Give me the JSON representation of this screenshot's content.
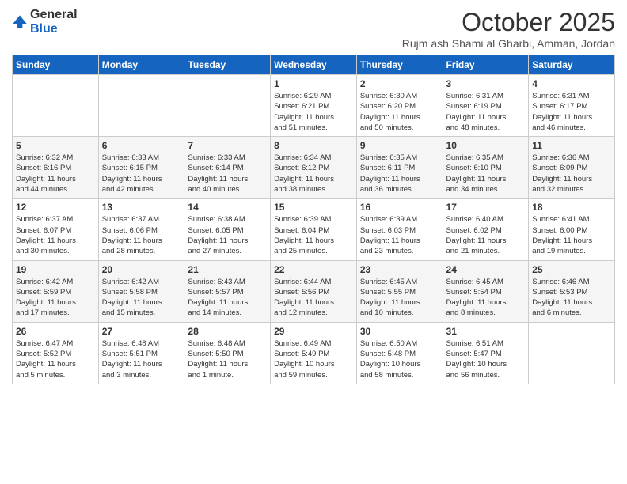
{
  "header": {
    "logo_general": "General",
    "logo_blue": "Blue",
    "month": "October 2025",
    "location": "Rujm ash Shami al Gharbi, Amman, Jordan"
  },
  "days_of_week": [
    "Sunday",
    "Monday",
    "Tuesday",
    "Wednesday",
    "Thursday",
    "Friday",
    "Saturday"
  ],
  "weeks": [
    [
      {
        "day": "",
        "info": ""
      },
      {
        "day": "",
        "info": ""
      },
      {
        "day": "",
        "info": ""
      },
      {
        "day": "1",
        "info": "Sunrise: 6:29 AM\nSunset: 6:21 PM\nDaylight: 11 hours\nand 51 minutes."
      },
      {
        "day": "2",
        "info": "Sunrise: 6:30 AM\nSunset: 6:20 PM\nDaylight: 11 hours\nand 50 minutes."
      },
      {
        "day": "3",
        "info": "Sunrise: 6:31 AM\nSunset: 6:19 PM\nDaylight: 11 hours\nand 48 minutes."
      },
      {
        "day": "4",
        "info": "Sunrise: 6:31 AM\nSunset: 6:17 PM\nDaylight: 11 hours\nand 46 minutes."
      }
    ],
    [
      {
        "day": "5",
        "info": "Sunrise: 6:32 AM\nSunset: 6:16 PM\nDaylight: 11 hours\nand 44 minutes."
      },
      {
        "day": "6",
        "info": "Sunrise: 6:33 AM\nSunset: 6:15 PM\nDaylight: 11 hours\nand 42 minutes."
      },
      {
        "day": "7",
        "info": "Sunrise: 6:33 AM\nSunset: 6:14 PM\nDaylight: 11 hours\nand 40 minutes."
      },
      {
        "day": "8",
        "info": "Sunrise: 6:34 AM\nSunset: 6:12 PM\nDaylight: 11 hours\nand 38 minutes."
      },
      {
        "day": "9",
        "info": "Sunrise: 6:35 AM\nSunset: 6:11 PM\nDaylight: 11 hours\nand 36 minutes."
      },
      {
        "day": "10",
        "info": "Sunrise: 6:35 AM\nSunset: 6:10 PM\nDaylight: 11 hours\nand 34 minutes."
      },
      {
        "day": "11",
        "info": "Sunrise: 6:36 AM\nSunset: 6:09 PM\nDaylight: 11 hours\nand 32 minutes."
      }
    ],
    [
      {
        "day": "12",
        "info": "Sunrise: 6:37 AM\nSunset: 6:07 PM\nDaylight: 11 hours\nand 30 minutes."
      },
      {
        "day": "13",
        "info": "Sunrise: 6:37 AM\nSunset: 6:06 PM\nDaylight: 11 hours\nand 28 minutes."
      },
      {
        "day": "14",
        "info": "Sunrise: 6:38 AM\nSunset: 6:05 PM\nDaylight: 11 hours\nand 27 minutes."
      },
      {
        "day": "15",
        "info": "Sunrise: 6:39 AM\nSunset: 6:04 PM\nDaylight: 11 hours\nand 25 minutes."
      },
      {
        "day": "16",
        "info": "Sunrise: 6:39 AM\nSunset: 6:03 PM\nDaylight: 11 hours\nand 23 minutes."
      },
      {
        "day": "17",
        "info": "Sunrise: 6:40 AM\nSunset: 6:02 PM\nDaylight: 11 hours\nand 21 minutes."
      },
      {
        "day": "18",
        "info": "Sunrise: 6:41 AM\nSunset: 6:00 PM\nDaylight: 11 hours\nand 19 minutes."
      }
    ],
    [
      {
        "day": "19",
        "info": "Sunrise: 6:42 AM\nSunset: 5:59 PM\nDaylight: 11 hours\nand 17 minutes."
      },
      {
        "day": "20",
        "info": "Sunrise: 6:42 AM\nSunset: 5:58 PM\nDaylight: 11 hours\nand 15 minutes."
      },
      {
        "day": "21",
        "info": "Sunrise: 6:43 AM\nSunset: 5:57 PM\nDaylight: 11 hours\nand 14 minutes."
      },
      {
        "day": "22",
        "info": "Sunrise: 6:44 AM\nSunset: 5:56 PM\nDaylight: 11 hours\nand 12 minutes."
      },
      {
        "day": "23",
        "info": "Sunrise: 6:45 AM\nSunset: 5:55 PM\nDaylight: 11 hours\nand 10 minutes."
      },
      {
        "day": "24",
        "info": "Sunrise: 6:45 AM\nSunset: 5:54 PM\nDaylight: 11 hours\nand 8 minutes."
      },
      {
        "day": "25",
        "info": "Sunrise: 6:46 AM\nSunset: 5:53 PM\nDaylight: 11 hours\nand 6 minutes."
      }
    ],
    [
      {
        "day": "26",
        "info": "Sunrise: 6:47 AM\nSunset: 5:52 PM\nDaylight: 11 hours\nand 5 minutes."
      },
      {
        "day": "27",
        "info": "Sunrise: 6:48 AM\nSunset: 5:51 PM\nDaylight: 11 hours\nand 3 minutes."
      },
      {
        "day": "28",
        "info": "Sunrise: 6:48 AM\nSunset: 5:50 PM\nDaylight: 11 hours\nand 1 minute."
      },
      {
        "day": "29",
        "info": "Sunrise: 6:49 AM\nSunset: 5:49 PM\nDaylight: 10 hours\nand 59 minutes."
      },
      {
        "day": "30",
        "info": "Sunrise: 6:50 AM\nSunset: 5:48 PM\nDaylight: 10 hours\nand 58 minutes."
      },
      {
        "day": "31",
        "info": "Sunrise: 6:51 AM\nSunset: 5:47 PM\nDaylight: 10 hours\nand 56 minutes."
      },
      {
        "day": "",
        "info": ""
      }
    ]
  ]
}
